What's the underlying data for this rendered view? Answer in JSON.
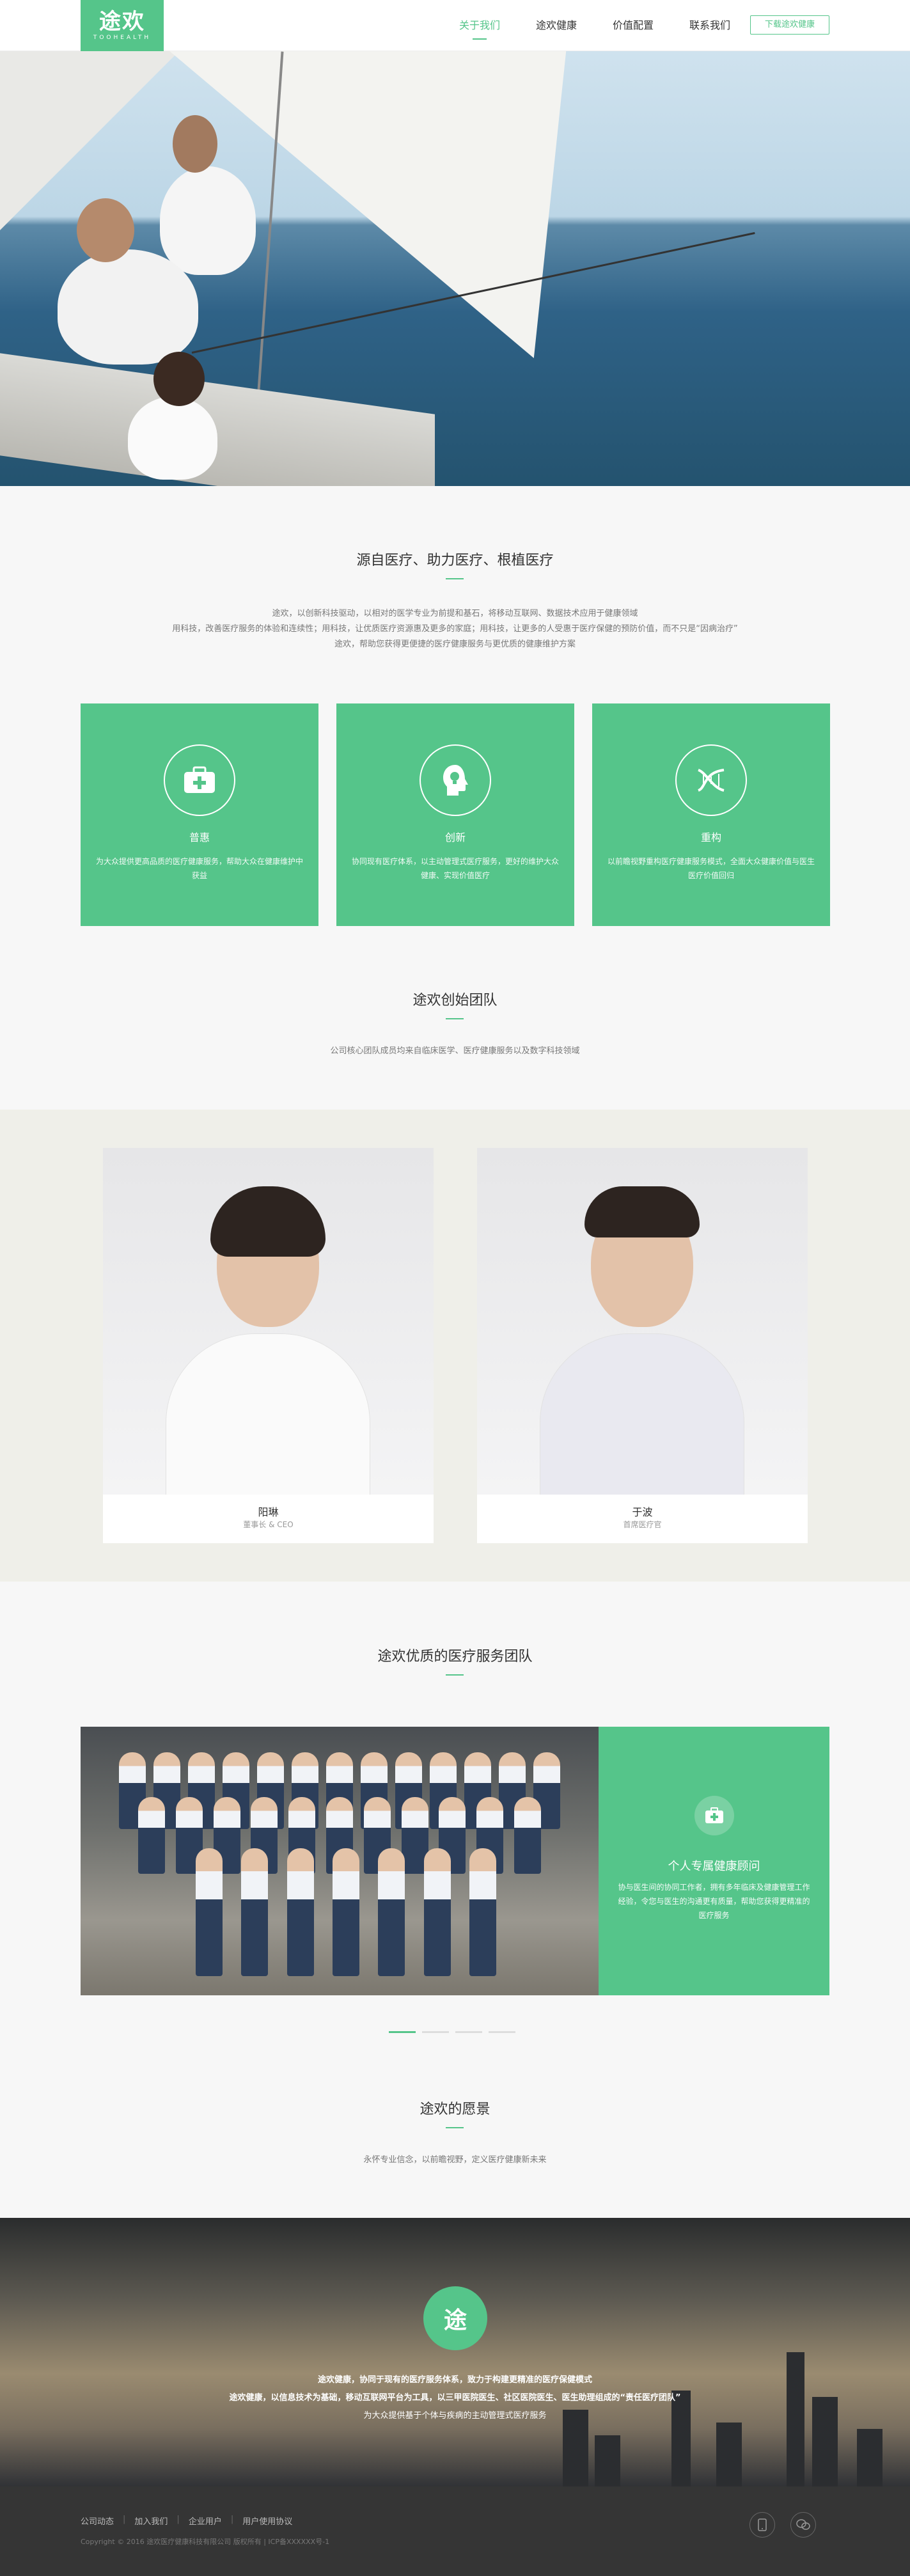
{
  "header": {
    "logo_text": "途欢",
    "logo_sub": "TOOHEALTH",
    "nav": [
      {
        "label": "关于我们"
      },
      {
        "label": "途欢健康"
      },
      {
        "label": "价值配置"
      },
      {
        "label": "联系我们"
      }
    ],
    "download_label": "下载途欢健康"
  },
  "intro": {
    "title": "源自医疗、助力医疗、根植医疗",
    "lines": [
      "途欢，以创新科技驱动，以相对的医学专业为前提和基石，将移动互联网、数据技术应用于健康领域",
      "用科技，改善医疗服务的体验和连续性；用科技，让优质医疗资源惠及更多的家庭；用科技，让更多的人受惠于医疗保健的预防价值，而不只是“因病治疗”",
      "途欢，帮助您获得更便捷的医疗健康服务与更优质的健康维护方案"
    ],
    "cards": [
      {
        "icon": "medical-kit",
        "title": "普惠",
        "desc": "为大众提供更高品质的医疗健康服务，帮助大众在健康维护中获益"
      },
      {
        "icon": "lightbulb-head",
        "title": "创新",
        "desc": "协同现有医疗体系，以主动管理式医疗服务，更好的维护大众健康、实现价值医疗"
      },
      {
        "icon": "dna",
        "title": "重构",
        "desc": "以前瞻视野重构医疗健康服务模式，全面大众健康价值与医生医疗价值回归"
      }
    ]
  },
  "founders": {
    "title": "途欢创始团队",
    "subtitle": "公司核心团队成员均来自临床医学、医疗健康服务以及数字科技领域",
    "members": [
      {
        "name": "阳琳",
        "role": "董事长 & CEO"
      },
      {
        "name": "于波",
        "role": "首席医疗官"
      }
    ]
  },
  "service": {
    "title": "途欢优质的医疗服务团队",
    "panel_title": "个人专属健康顾问",
    "panel_desc": "协与医生间的协同工作者，拥有多年临床及健康管理工作经验，令您与医生的沟通更有质量，帮助您获得更精准的医疗服务"
  },
  "vision": {
    "title": "途欢的愿景",
    "subtitle": "永怀专业信念，以前瞻视野，定义医疗健康新未来",
    "logo_text": "途",
    "lines": [
      "途欢健康，协同于现有的医疗服务体系，致力于构建更精准的医疗保健模式",
      "途欢健康，以信息技术为基础，移动互联网平台为工具，以三甲医院医生、社区医院医生、医生助理组成的“责任医疗团队”",
      "为大众提供基于个体与疾病的主动管理式医疗服务"
    ]
  },
  "footer": {
    "links": [
      "公司动态",
      "加入我们",
      "企业用户",
      "用户使用协议"
    ],
    "copyright": "Copyright © 2016 途欢医疗健康科技有限公司 版权所有 | ICP备XXXXXX号-1"
  },
  "colors": {
    "accent": "#55c58a",
    "footer": "#353535"
  }
}
